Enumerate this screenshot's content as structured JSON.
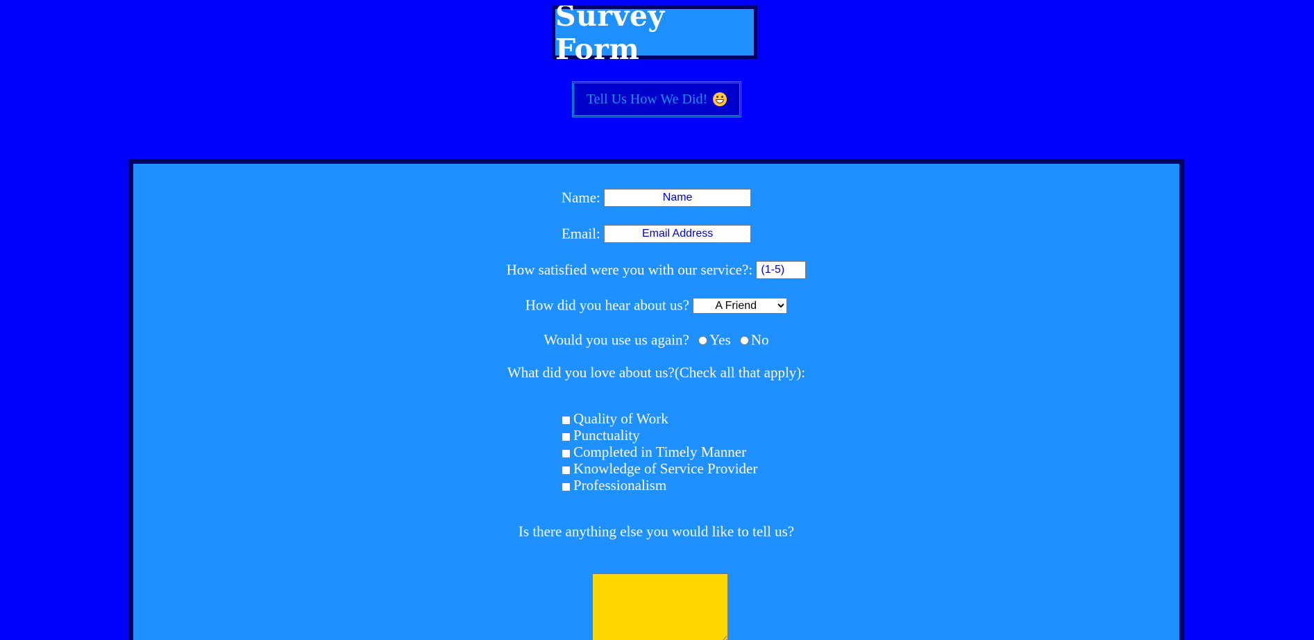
{
  "header": {
    "title": "Survey Form",
    "tagline": "Tell Us How We Did!"
  },
  "form": {
    "name": {
      "label": "Name:",
      "placeholder": "Name",
      "value": ""
    },
    "email": {
      "label": "Email:",
      "placeholder": "Email Address",
      "value": ""
    },
    "satisfaction": {
      "label": "How satisfied were you with our service?:",
      "placeholder": "(1-5)",
      "value": ""
    },
    "referral": {
      "label": "How did you hear about us?",
      "selected": "A Friend"
    },
    "use_again": {
      "label": "Would you use us again?",
      "options": [
        "Yes",
        "No"
      ]
    },
    "loved": {
      "label": "What did you love about us?(Check all that apply):",
      "options": [
        "Quality of Work",
        "Punctuality",
        "Completed in Timely Manner",
        "Knowledge of Service Provider",
        "Professionalism"
      ]
    },
    "comments": {
      "label": "Is there anything else you would like to tell us?"
    }
  },
  "colors": {
    "page_background": "#0000FF",
    "panel_background": "#1E90FF",
    "border": "#000066",
    "textarea_background": "#FFD700",
    "input_text": "#0000CD"
  },
  "icons": {
    "tagline_emoji": "grinning-face-icon"
  }
}
